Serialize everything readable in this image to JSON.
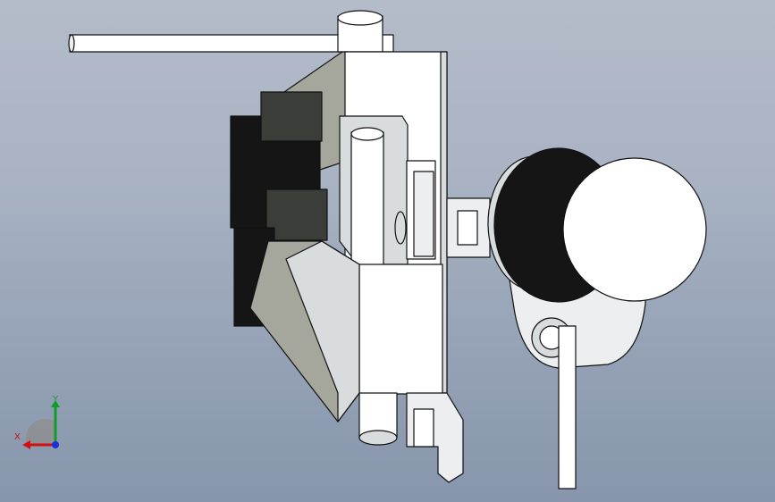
{
  "viewport": {
    "background_top": "#b4bcc9",
    "background_bottom": "#8796ac"
  },
  "model": {
    "colors": {
      "white_part": "#ffffff",
      "white_shade": "#eceef0",
      "light_gray": "#d9dcdc",
      "mid_gray": "#a5a79c",
      "dark_gray": "#3b3d39",
      "black_part": "#151515",
      "edge": "#111111"
    }
  },
  "triad": {
    "x_label": "X",
    "y_label": "Y",
    "x_color": "#d01010",
    "y_color": "#0f9d2a",
    "z_color": "#1a2fd6"
  }
}
